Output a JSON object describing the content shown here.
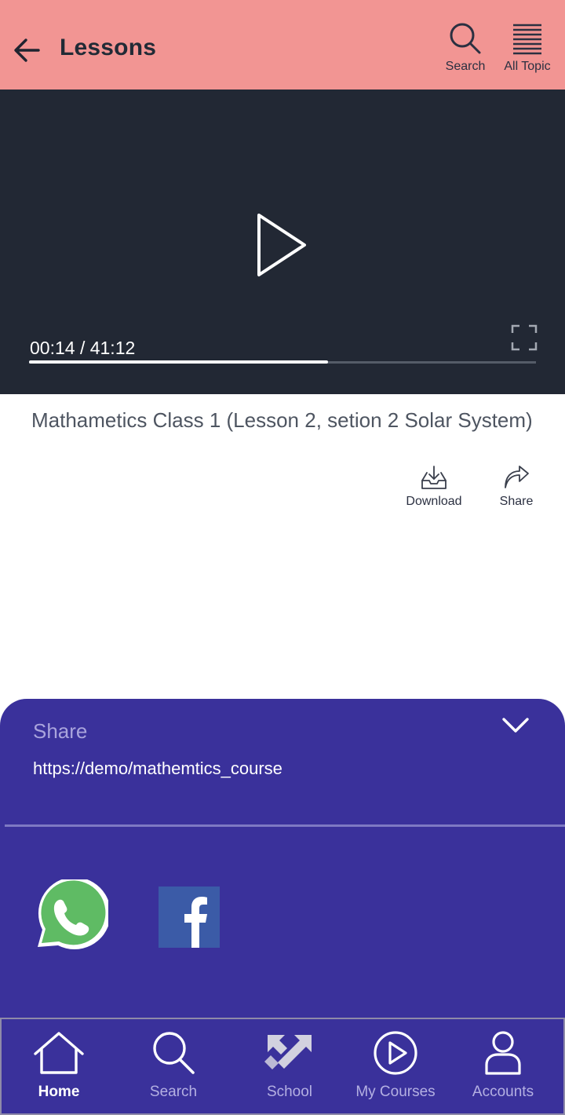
{
  "header": {
    "title": "Lessons",
    "back_icon": "arrow-left-icon",
    "actions": [
      {
        "label": "Search",
        "icon": "search-icon"
      },
      {
        "label": "All Topic",
        "icon": "list-icon"
      }
    ]
  },
  "video": {
    "time": "00:14 / 41:12",
    "progress_fraction": 0.59,
    "play_icon": "play-icon",
    "fullscreen_icon": "fullscreen-icon"
  },
  "lesson": {
    "title": "Mathametics Class 1 (Lesson 2, setion 2  Solar System)",
    "actions": [
      {
        "label": "Download",
        "icon": "download-tray-icon"
      },
      {
        "label": "Share",
        "icon": "share-arrow-icon"
      }
    ]
  },
  "share_sheet": {
    "heading": "Share",
    "link": "https://demo/mathemtics_course",
    "collapse_icon": "chevron-down-icon",
    "targets": [
      {
        "icon": "whatsapp-icon"
      },
      {
        "icon": "facebook-icon"
      }
    ]
  },
  "bottom_nav": {
    "items": [
      {
        "label": "Home",
        "icon": "home-icon",
        "active": true
      },
      {
        "label": "Search",
        "icon": "search-icon",
        "active": false
      },
      {
        "label": "School",
        "icon": "school-arrows-icon",
        "active": false
      },
      {
        "label": "My Courses",
        "icon": "play-circle-icon",
        "active": false
      },
      {
        "label": "Accounts",
        "icon": "user-icon",
        "active": false
      }
    ]
  },
  "colors": {
    "header_bg": "#f29593",
    "video_bg": "#222834",
    "sheet_bg": "#3a319b",
    "whatsapp_green": "#5fbb64",
    "facebook_blue": "#3b5ba7"
  }
}
